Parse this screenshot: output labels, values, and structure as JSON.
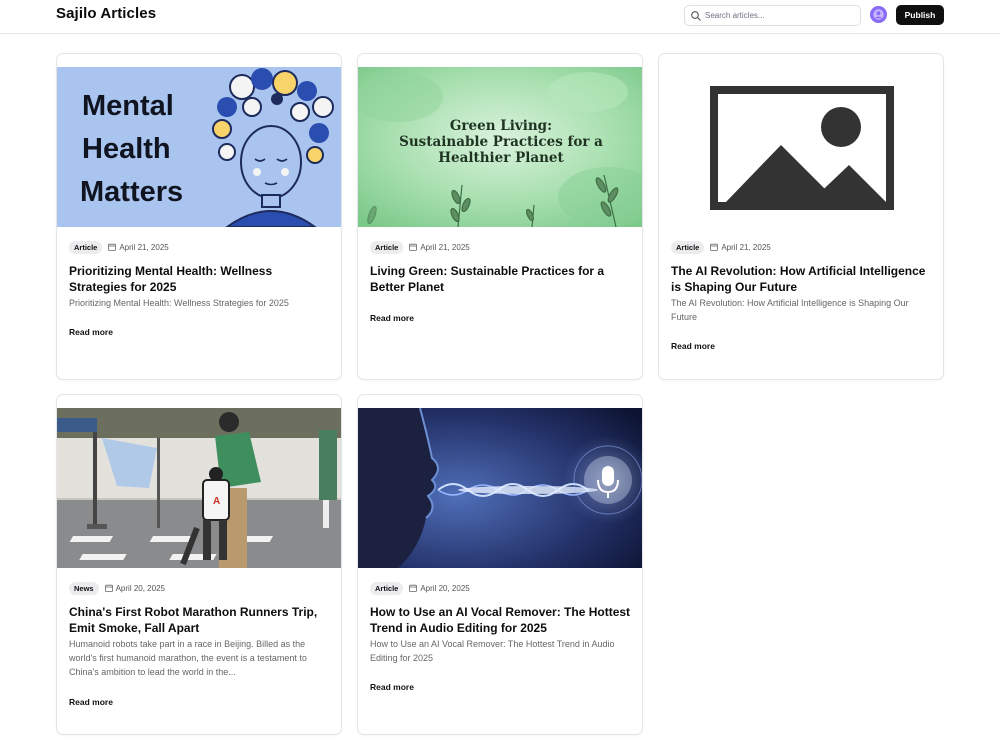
{
  "header": {
    "brand": "Sajilo Articles",
    "search_placeholder": "Search articles...",
    "publish_label": "Publish"
  },
  "colors": {
    "accent": "#0f0f10",
    "avatar": "#8b6cf6",
    "badge_bg": "#ececef"
  },
  "cards": [
    {
      "badge": "Article",
      "date": "April 21, 2025",
      "title": "Prioritizing Mental Health: Wellness Strategies for 2025",
      "excerpt": "Prioritizing Mental Health: Wellness Strategies for 2025",
      "read_more": "Read more",
      "image_text": [
        "Mental",
        "Health",
        "Matters"
      ]
    },
    {
      "badge": "Article",
      "date": "April 21, 2025",
      "title": "Living Green: Sustainable Practices for a Better Planet",
      "excerpt": "",
      "read_more": "Read more",
      "image_text": [
        "Green Living:",
        "Sustainable Practices for a",
        "Healthier Planet"
      ]
    },
    {
      "badge": "Article",
      "date": "April 21, 2025",
      "title": "The AI Revolution: How Artificial Intelligence is Shaping Our Future",
      "excerpt": "The AI Revolution: How Artificial Intelligence is Shaping Our Future",
      "read_more": "Read more",
      "image_icon": "image-placeholder-icon"
    },
    {
      "badge": "News",
      "date": "April 20, 2025",
      "title": "China's First Robot Marathon Runners Trip, Emit Smoke, Fall Apart",
      "excerpt": "Humanoid robots take part in a race in Beijing. Billed as the world's first humanoid marathon, the event is a testament to China's ambition to lead the world in the...",
      "read_more": "Read more"
    },
    {
      "badge": "Article",
      "date": "April 20, 2025",
      "title": "How to Use an AI Vocal Remover: The Hottest Trend in Audio Editing for 2025",
      "excerpt": "How to Use an AI Vocal Remover: The Hottest Trend in Audio Editing for 2025",
      "read_more": "Read more",
      "image_icon": "microphone-icon"
    }
  ]
}
